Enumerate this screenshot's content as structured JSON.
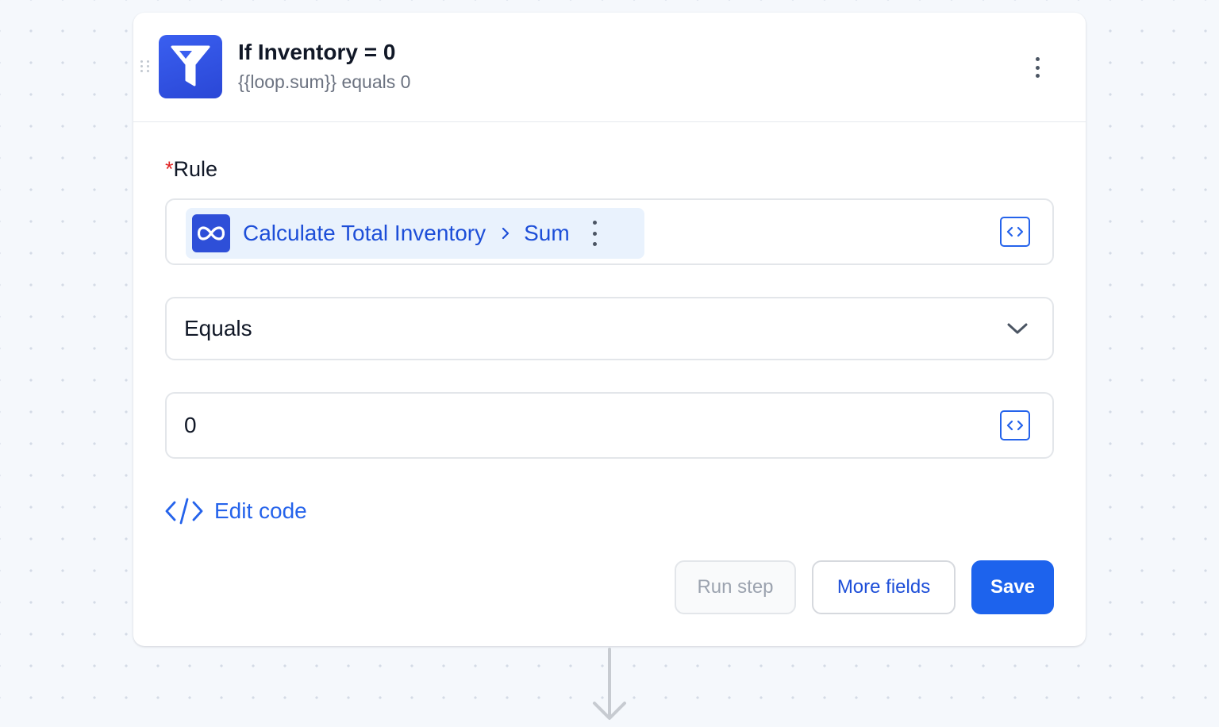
{
  "step": {
    "title": "If Inventory = 0",
    "subtitle": "{{loop.sum}} equals 0",
    "icon": "filter-funnel-icon"
  },
  "rule": {
    "label": "Rule",
    "required_marker": "*",
    "chip": {
      "icon": "loop-infinity-icon",
      "source": "Calculate Total Inventory",
      "field": "Sum"
    }
  },
  "operator": {
    "selected": "Equals"
  },
  "value": {
    "text": "0"
  },
  "edit_code": {
    "label": "Edit code"
  },
  "buttons": {
    "run_step": "Run step",
    "more_fields": "More fields",
    "save": "Save"
  },
  "colors": {
    "accent": "#1d63ed",
    "icon_bg": "#2e4fd8",
    "chip_bg": "#e9f2fd",
    "required": "#e02424"
  }
}
